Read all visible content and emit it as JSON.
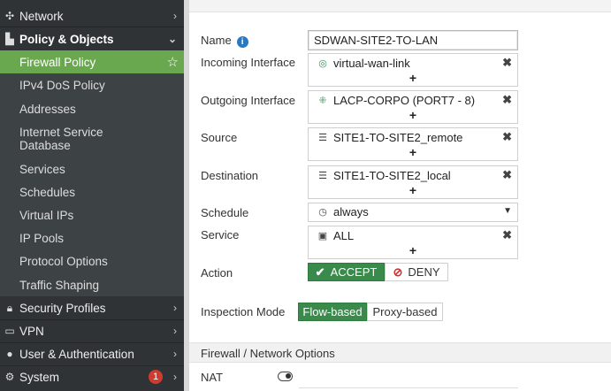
{
  "sidebar": {
    "network": "Network",
    "policy_objects": "Policy & Objects",
    "items": [
      {
        "label": "Firewall Policy"
      },
      {
        "label": "IPv4 DoS Policy"
      },
      {
        "label": "Addresses"
      },
      {
        "label": "Internet Service Database"
      },
      {
        "label": "Services"
      },
      {
        "label": "Schedules"
      },
      {
        "label": "Virtual IPs"
      },
      {
        "label": "IP Pools"
      },
      {
        "label": "Protocol Options"
      },
      {
        "label": "Traffic Shaping"
      }
    ],
    "internet_service_line1": "Internet Service",
    "internet_service_line2": "Database",
    "security_profiles": "Security Profiles",
    "vpn": "VPN",
    "user_auth": "User & Authentication",
    "system": "System",
    "system_badge": "1"
  },
  "form": {
    "name_label": "Name",
    "name_value": "SDWAN-SITE2-TO-LAN",
    "incoming_label": "Incoming Interface",
    "incoming_value": "virtual-wan-link",
    "outgoing_label": "Outgoing Interface",
    "outgoing_value": "LACP-CORPO (PORT7 - 8)",
    "source_label": "Source",
    "source_value": "SITE1-TO-SITE2_remote",
    "destination_label": "Destination",
    "destination_value": "SITE1-TO-SITE2_local",
    "schedule_label": "Schedule",
    "schedule_value": "always",
    "service_label": "Service",
    "service_value": "ALL",
    "action_label": "Action",
    "accept_label": "ACCEPT",
    "deny_label": "DENY",
    "inspection_label": "Inspection Mode",
    "flow_label": "Flow-based",
    "proxy_label": "Proxy-based",
    "section_title": "Firewall / Network Options",
    "nat_label": "NAT",
    "plus": "+",
    "remove": "✖"
  },
  "colors": {
    "sidebar_bg": "#2f3336",
    "active_green": "#6aa84f",
    "accept_green": "#3a8a4b",
    "badge_red": "#d03b2f"
  }
}
